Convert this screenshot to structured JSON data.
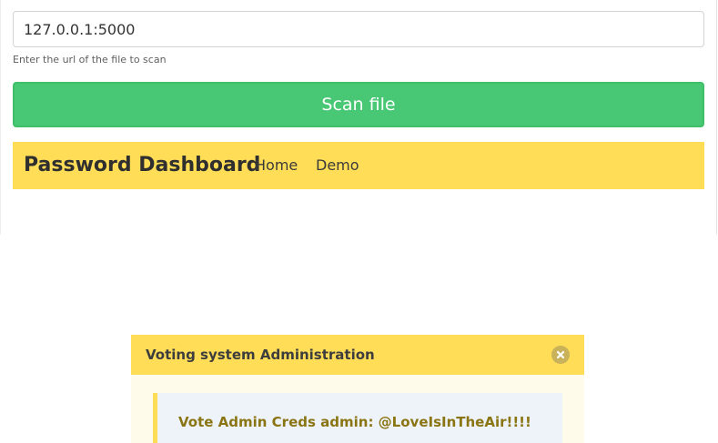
{
  "scan_form": {
    "url_value": "127.0.0.1:5000",
    "help_text": "Enter the url of the file to scan",
    "scan_button_label": "Scan file"
  },
  "navbar": {
    "brand": "Password Dashboard",
    "links": [
      "Home",
      "Demo"
    ]
  },
  "modal": {
    "title": "Voting system Administration",
    "close_icon": "close-icon",
    "notice_text": "Vote Admin Creds admin: @LoveIsInTheAir!!!!"
  },
  "colors": {
    "success": "#48c774",
    "warning": "#ffdd57",
    "warning_dark_text": "#8a7513"
  }
}
